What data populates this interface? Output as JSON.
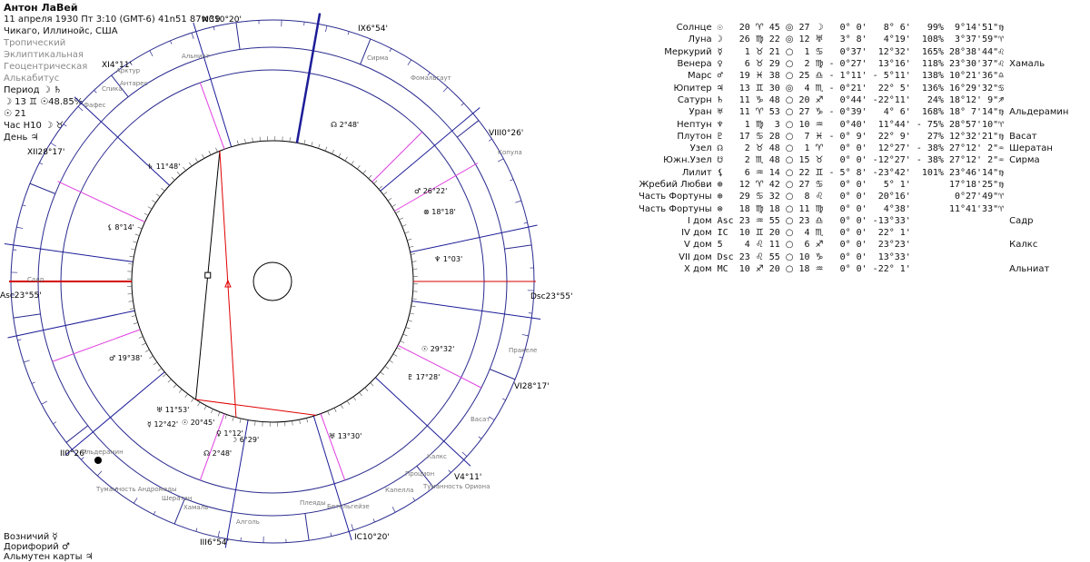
{
  "header": {
    "name": "Антон ЛаВей",
    "date_line": "11 апреля 1930  Пт   3:10 (GMT-6) 41n51  87w39",
    "place": "Чикаго, Иллинойс, США",
    "settings": [
      "Тропический",
      "Эклиптикальная",
      "Геоцентрическая",
      "Алькабитус"
    ],
    "period_label": "Период",
    "period_glyphs": "☽ ♄",
    "phase_line": "☽  13 ♊ ☉48.85%",
    "sun_line": "☉  21",
    "hour_line": "Час Н10 ☽ ♉",
    "day_line": "День ♃"
  },
  "footer": {
    "lines": [
      "Возничий ☿",
      "Дорифорий ♂",
      "Альмутен карты ♃"
    ]
  },
  "cusps": {
    "mc": "MC10°20'",
    "ic": "IC10°20'",
    "asc": "Asc23°55'",
    "dsc": "Dsc23°55'",
    "h2": "II0°26'",
    "h3": "III6°54'",
    "h5": "V4°11'",
    "h6": "VI28°17'",
    "h8": "VIII0°26'",
    "h9": "IX6°54'",
    "h11": "XI4°11'",
    "h12": "XII28°17'"
  },
  "stars": [
    "Альниат",
    "Сирма",
    "Фомальгаут",
    "Арктур",
    "Антарес",
    "Спика",
    "Фафес",
    "Копула",
    "Садр",
    "Альдерамин",
    "Туманность Андромеды",
    "Шератан",
    "Хамаль",
    "Алголь",
    "Плеяды",
    "Капелла",
    "Процион",
    "Васат",
    "Калкс",
    "Туманность Ориона",
    "Бетельгейзе",
    "Пракеле"
  ],
  "inner_labels": [
    "♄ 11°48'",
    "☊ 2°48'",
    "♂ 26°22'",
    "⊗ 18°18'",
    "♆ 1°03'",
    "☉ 29°32'",
    "♇ 17°28'",
    "♅ 13°30'",
    "⚸ 8°14'",
    "♂ 19°38'",
    "♅ 11°53'",
    "☿ 12°42'",
    "☉ 20°45'",
    "♀ 1°12'",
    "☽ 6°29'",
    "☊ 2°48'"
  ],
  "planets": [
    {
      "name": "Солнце",
      "g": "☉",
      "deg": "20",
      "sign": "♈",
      "min": "45",
      "asp": "◎",
      "h": "27",
      "hs": "☽",
      "lat": "0° 0'",
      "decl": "8° 6'",
      "pct": "99%",
      "ant": "9°14'51\"♍",
      "star": ""
    },
    {
      "name": "Луна",
      "g": "☽",
      "deg": "26",
      "sign": "♍",
      "min": "22",
      "asp": "◎",
      "h": "12",
      "hs": "♅",
      "lat": "3° 8'",
      "decl": "4°19'",
      "pct": "108%",
      "ant": "3°37'59\"♈",
      "star": ""
    },
    {
      "name": "Меркурий",
      "g": "☿",
      "deg": "1",
      "sign": "♉",
      "min": "21",
      "asp": "○",
      "h": "1",
      "hs": "♋",
      "lat": "0°37'",
      "decl": "12°32'",
      "pct": "165%",
      "ant": "28°38'44\"♌",
      "star": ""
    },
    {
      "name": "Венера",
      "g": "♀",
      "deg": "6",
      "sign": "♉",
      "min": "29",
      "asp": "○",
      "h": "2",
      "hs": "♍",
      "lat": "- 0°27'",
      "decl": "13°16'",
      "pct": "118%",
      "ant": "23°30'37\"♌",
      "star": "Хамаль"
    },
    {
      "name": "Марс",
      "g": "♂",
      "deg": "19",
      "sign": "♓",
      "min": "38",
      "asp": "○",
      "h": "25",
      "hs": "♎",
      "lat": "- 1°11'",
      "decl": "- 5°11'",
      "pct": "138%",
      "ant": "10°21'36\"♎",
      "star": ""
    },
    {
      "name": "Юпитер",
      "g": "♃",
      "deg": "13",
      "sign": "♊",
      "min": "30",
      "asp": "◎",
      "h": "4",
      "hs": "♏",
      "lat": "- 0°21'",
      "decl": "22° 5'",
      "pct": "136%",
      "ant": "16°29'32\"♋",
      "star": ""
    },
    {
      "name": "Сатурн",
      "g": "♄",
      "deg": "11",
      "sign": "♑",
      "min": "48",
      "asp": "○",
      "h": "20",
      "hs": "♐",
      "lat": "0°44'",
      "decl": "-22°11'",
      "pct": "24%",
      "ant": "18°12' 9\"♐",
      "star": ""
    },
    {
      "name": "Уран",
      "g": "♅",
      "deg": "11",
      "sign": "♈",
      "min": "53",
      "asp": "○",
      "h": "27",
      "hs": "♑",
      "lat": "- 0°39'",
      "decl": "4° 6'",
      "pct": "168%",
      "ant": "18° 7'14\"♍",
      "star": "Альдерамин"
    },
    {
      "name": "Нептун",
      "g": "♆",
      "deg": "1",
      "sign": "♍",
      "min": "3",
      "asp": "○",
      "h": "10",
      "hs": "♒",
      "lat": "0°40'",
      "decl": "11°44'",
      "pct": "- 75%",
      "ant": "28°57'10\"♈",
      "star": ""
    },
    {
      "name": "Плутон",
      "g": "♇",
      "deg": "17",
      "sign": "♋",
      "min": "28",
      "asp": "○",
      "h": "7",
      "hs": "♓",
      "lat": "- 0° 9'",
      "decl": "22° 9'",
      "pct": "27%",
      "ant": "12°32'21\"♍",
      "star": "Васат"
    },
    {
      "name": "Узел",
      "g": "☊",
      "deg": "2",
      "sign": "♉",
      "min": "48",
      "asp": "○",
      "h": "1",
      "hs": "♈",
      "lat": "0° 0'",
      "decl": "12°27'",
      "pct": "- 38%",
      "ant": "27°12' 2\"♒",
      "star": "Шератан"
    },
    {
      "name": "Южн.Узел",
      "g": "☋",
      "deg": "2",
      "sign": "♏",
      "min": "48",
      "asp": "○",
      "h": "15",
      "hs": "♉",
      "lat": "0° 0'",
      "decl": "-12°27'",
      "pct": "- 38%",
      "ant": "27°12' 2\"♒",
      "star": "Сирма"
    },
    {
      "name": "Лилит",
      "g": "⚸",
      "deg": "6",
      "sign": "♒",
      "min": "14",
      "asp": "○",
      "h": "22",
      "hs": "♊",
      "lat": "- 5° 8'",
      "decl": "-23°42'",
      "pct": "101%",
      "ant": "23°46'14\"♍",
      "star": ""
    },
    {
      "name": "Жребий Любви",
      "g": "⊕",
      "deg": "12",
      "sign": "♈",
      "min": "42",
      "asp": "○",
      "h": "27",
      "hs": "♋",
      "lat": "0° 0'",
      "decl": "5° 1'",
      "pct": "",
      "ant": "17°18'25\"♍",
      "star": ""
    },
    {
      "name": "Часть Фортуны",
      "g": "⊕",
      "deg": "29",
      "sign": "♋",
      "min": "32",
      "asp": "○",
      "h": "8",
      "hs": "♌",
      "lat": "0° 0'",
      "decl": "20°16'",
      "pct": "",
      "ant": "0°27'49\"♈",
      "star": ""
    },
    {
      "name": "Часть Фортуны",
      "g": "⊗",
      "deg": "18",
      "sign": "♍",
      "min": "18",
      "asp": "○",
      "h": "11",
      "hs": "♍",
      "lat": "0° 0'",
      "decl": "4°38'",
      "pct": "",
      "ant": "11°41'33\"♈",
      "star": ""
    },
    {
      "name": "I дом",
      "g": "Asc",
      "deg": "23",
      "sign": "♒",
      "min": "55",
      "asp": "○",
      "h": "23",
      "hs": "♎",
      "lat": "0° 0'",
      "decl": "-13°33'",
      "pct": "",
      "ant": "",
      "star": "Садр"
    },
    {
      "name": "IV дом",
      "g": "IC",
      "deg": "10",
      "sign": "♊",
      "min": "20",
      "asp": "○",
      "h": "4",
      "hs": "♏",
      "lat": "0° 0'",
      "decl": "22° 1'",
      "pct": "",
      "ant": "",
      "star": ""
    },
    {
      "name": "V дом",
      "g": "5",
      "deg": "4",
      "sign": "♌",
      "min": "11",
      "asp": "○",
      "h": "6",
      "hs": "♐",
      "lat": "0° 0'",
      "decl": "23°23'",
      "pct": "",
      "ant": "",
      "star": "Калкс"
    },
    {
      "name": "VII дом",
      "g": "Dsc",
      "deg": "23",
      "sign": "♌",
      "min": "55",
      "asp": "○",
      "h": "10",
      "hs": "♑",
      "lat": "0° 0'",
      "decl": "13°33'",
      "pct": "",
      "ant": "",
      "star": ""
    },
    {
      "name": "X дом",
      "g": "MC",
      "deg": "10",
      "sign": "♐",
      "min": "20",
      "asp": "○",
      "h": "18",
      "hs": "♒",
      "lat": "0° 0'",
      "decl": "-22° 1'",
      "pct": "",
      "ant": "",
      "star": "Альниат"
    }
  ]
}
